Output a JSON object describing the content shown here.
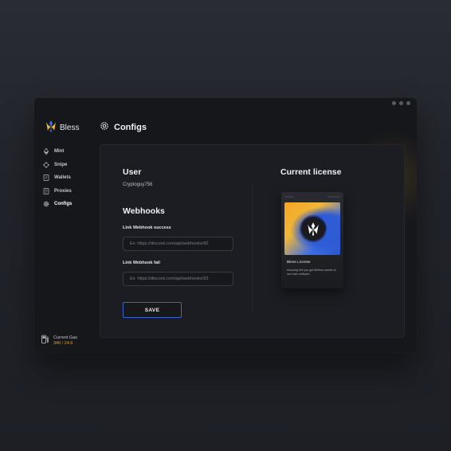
{
  "app": {
    "name": "Bless"
  },
  "sidebar": {
    "items": [
      {
        "label": "Mint",
        "icon": "ethereum-icon",
        "active": false
      },
      {
        "label": "Snipe",
        "icon": "crosshair-icon",
        "active": false
      },
      {
        "label": "Wallets",
        "icon": "wallet-icon",
        "active": false
      },
      {
        "label": "Proxies",
        "icon": "document-icon",
        "active": false
      },
      {
        "label": "Configs",
        "icon": "gear-icon",
        "active": true
      }
    ],
    "gas": {
      "label": "Current Gas",
      "value": "340 / 24.6",
      "icon": "fuel-pump-icon"
    }
  },
  "header": {
    "title": "Configs",
    "icon": "gear-icon"
  },
  "user": {
    "heading": "User",
    "username": "Cryptoguy756"
  },
  "webhooks": {
    "heading": "Webhooks",
    "success": {
      "label": "Link Webhook success",
      "placeholder": "Ex: https://discord.com/api/webhooks/92",
      "value": ""
    },
    "fail": {
      "label": "Link Webhook fail",
      "placeholder": "Ex: https://discord.com/api/webhooks/93",
      "value": ""
    },
    "save_label": "SAVE"
  },
  "license": {
    "heading": "Current license",
    "card_name": "Bless License",
    "card_description": "Assuring this you get lifetime access to our main software"
  },
  "colors": {
    "accent_blue": "#3c64c8",
    "accent_gold": "#d9a23a",
    "window_bg": "#16171b",
    "panel_bg": "#1c1d22"
  }
}
